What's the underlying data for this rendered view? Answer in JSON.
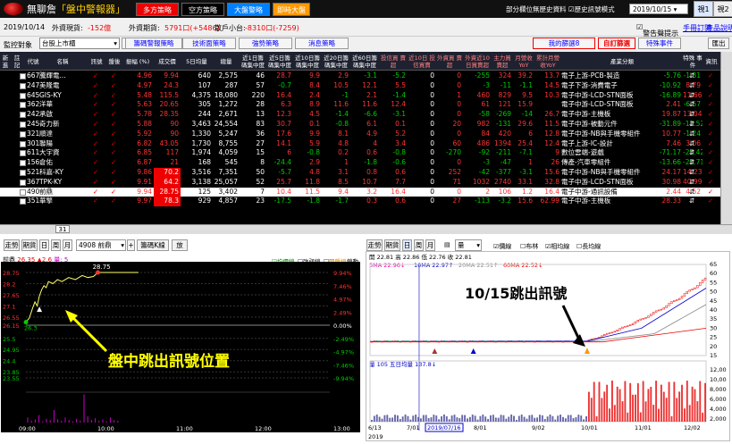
{
  "titlebar": {
    "app_name": "無聊詹",
    "app_subtitle": "「盤中警報器」",
    "buttons": [
      "多方策略",
      "空方策略",
      "大盤警略",
      "即時大盤"
    ],
    "right_links": [
      "部分欄位無歷史資料",
      "歷史訊號模式"
    ],
    "date": "2019/10/15",
    "window_tabs": [
      "視1",
      "視2"
    ]
  },
  "infobar": {
    "date": "2019/10/14",
    "foreign_futures_label": "外資現貨:",
    "foreign_futures_value": "-152億",
    "foreign_spot_label": "外資期貨:",
    "foreign_spot_value": "5791口(+5486)",
    "retail_label": "散戶小台:",
    "retail_value": "-8310口(-7259)",
    "alert_label": "警告聲提示",
    "manual_link": "手冊訂閱",
    "product_link": "產品說明"
  },
  "toolbar": {
    "monitor_label": "監控對象",
    "monitor_value": "台股上市櫃",
    "buttons": [
      "籌碼警報策略",
      "技術面策略",
      "強勢策略",
      "消息策略"
    ],
    "my_strategy": "我的篩選8",
    "custom_strategy": "自訂篩選",
    "special_event": "特殊事件",
    "export": "匯出"
  },
  "table": {
    "headers": [
      "新\n進",
      "註\n記",
      "代號",
      "名稱",
      "訊號",
      "盤後",
      "振幅\n(%)",
      "成交價",
      "5日均量",
      "總量",
      "近1日籌\n碼集中度",
      "近5日籌\n碼集中度",
      "近10日籌\n碼集中度",
      "近20日籌\n碼集中度",
      "近60日籌\n碼集中度",
      "投信買\n賣超",
      "近10日\n投信買賣",
      "外資買\n賣超",
      "外資近10\n日買賣超",
      "主力買\n賣超",
      "月營收\nYoY",
      "累計月營\n收YoY",
      "產業分類",
      "特殊\n事件",
      "資訊"
    ],
    "rows": [
      {
        "code": "6672",
        "name": "騰輝電...",
        "amp": "4.96",
        "chg": "9.94",
        "price": "640",
        "vol5": "2,575",
        "vol": "46",
        "c1": "28.7",
        "c5": "9.9",
        "c10": "2.9",
        "c20": "-3.1",
        "c60": "-5.2",
        "tb": "0",
        "tb10": "0",
        "fb": "-255",
        "fb10": "324",
        "mb": "39.2",
        "yoy": "13.7",
        "cyoy": "-5.76",
        "cyoy2": "-1.31",
        "ind": "電子上游-PCB-製造"
      },
      {
        "code": "2477",
        "name": "美隆電",
        "amp": "4.97",
        "chg": "24.3",
        "price": "107",
        "vol5": "287",
        "vol": "57",
        "c1": "-0.7",
        "c5": "8.4",
        "c10": "10.5",
        "c20": "12.1",
        "c60": "5.5",
        "tb": "0",
        "tb10": "0",
        "fb": "-3",
        "fb10": "-11",
        "mb": "-1.1",
        "yoy": "14.5",
        "cyoy": "-10.92",
        "cyoy2": "8.79",
        "ind": "電子下游-消費電子"
      },
      {
        "code": "6456",
        "name": "GIS-KY",
        "amp": "5.48",
        "chg": "115.5",
        "price": "4,375",
        "vol5": "18,080",
        "vol": "220",
        "c1": "16.4",
        "c5": "2.4",
        "c10": "-1",
        "c20": "2.1",
        "c60": "-1.4",
        "tb": "0",
        "tb10": "1",
        "fb": "460",
        "fb10": "829",
        "mb": "9.5",
        "yoy": "10.3",
        "cyoy": "-16.89",
        "cyoy2": "11.66",
        "ind": "電子中游-LCD-STN面板"
      },
      {
        "code": "3622",
        "name": "洋華",
        "amp": "5.63",
        "chg": "20.65",
        "price": "305",
        "vol5": "1,272",
        "vol": "28",
        "c1": "6.3",
        "c5": "8.9",
        "c10": "11.6",
        "c20": "11.6",
        "c60": "12.4",
        "tb": "0",
        "tb10": "0",
        "fb": "61",
        "fb10": "121",
        "mb": "15.9",
        "yoy": "",
        "cyoy": "2.41",
        "cyoy2": "-6.57",
        "ind": "電子中游-LCD-STN面板"
      },
      {
        "code": "2425",
        "name": "承啟",
        "amp": "5.78",
        "chg": "28.35",
        "price": "244",
        "vol5": "2,671",
        "vol": "13",
        "c1": "12.3",
        "c5": "4.5",
        "c10": "-1.4",
        "c20": "-6.6",
        "c60": "-3.1",
        "tb": "0",
        "tb10": "0",
        "fb": "-58",
        "fb10": "-269",
        "mb": "-14",
        "yoy": "26.7",
        "cyoy": "19.87",
        "cyoy2": "13.04",
        "ind": "電子中游-主機板"
      },
      {
        "code": "2456",
        "name": "奇力新",
        "amp": "5.88",
        "chg": "90",
        "price": "3,463",
        "vol5": "24,554",
        "vol": "83",
        "c1": "30.7",
        "c5": "0.1",
        "c10": "-0.8",
        "c20": "6.1",
        "c60": "0.1",
        "tb": "0",
        "tb10": "20",
        "fb": "982",
        "fb10": "-131",
        "mb": "29.6",
        "yoy": "11.5",
        "cyoy": "-31.89",
        "cyoy2": "-11.52",
        "ind": "電子中游-被動元件"
      },
      {
        "code": "3211",
        "name": "順達",
        "amp": "5.92",
        "chg": "90",
        "price": "1,330",
        "vol5": "5,247",
        "vol": "36",
        "c1": "17.6",
        "c5": "9.9",
        "c10": "8.1",
        "c20": "4.9",
        "c60": "5.2",
        "tb": "0",
        "tb10": "0",
        "fb": "84",
        "fb10": "420",
        "mb": "6",
        "yoy": "12.8",
        "cyoy": "10.77",
        "cyoy2": "-1.24",
        "ind": "電子中游-NB與手機零組件"
      },
      {
        "code": "3014",
        "name": "聯陽",
        "amp": "6.82",
        "chg": "43.05",
        "price": "1,730",
        "vol5": "8,755",
        "vol": "27",
        "c1": "14.1",
        "c5": "5.9",
        "c10": "4.8",
        "c20": "4",
        "c60": "3.4",
        "tb": "0",
        "tb10": "60",
        "fb": "486",
        "fb10": "1394",
        "mb": "25.4",
        "yoy": "12.4",
        "cyoy": "7.46",
        "cyoy2": "3.06",
        "ind": "電子上游-IC-設計"
      },
      {
        "code": "6111",
        "name": "大宇資",
        "amp": "6.85",
        "chg": "117",
        "price": "1,974",
        "vol5": "4,059",
        "vol": "15",
        "c1": "6",
        "c5": "-0.8",
        "c10": "0.2",
        "c20": "0.6",
        "c60": "-0.8",
        "tb": "0",
        "tb10": "-270",
        "fb": "-92",
        "fb10": "-211",
        "mb": "-7.1",
        "yoy": "9",
        "cyoy": "-71.17",
        "cyoy2": "-25.42",
        "ind": "數位雲端-遊戲"
      },
      {
        "code": "1568",
        "name": "倉佑",
        "amp": "6.87",
        "chg": "21",
        "price": "168",
        "vol5": "545",
        "vol": "8",
        "c1": "-24.4",
        "c5": "2.9",
        "c10": "1",
        "c20": "-1.8",
        "c60": "-0.6",
        "tb": "0",
        "tb10": "0",
        "fb": "-3",
        "fb10": "-47",
        "mb": "1",
        "yoy": "26",
        "cyoy": "-13.66",
        "cyoy2": "-25.71",
        "ind": "傳產-汽車零組件"
      },
      {
        "code": "5215",
        "name": "科嘉-KY",
        "amp": "9.86",
        "chg": "70.2",
        "price": "3,516",
        "vol5": "7,351",
        "vol": "50",
        "c1": "-5.7",
        "c5": "4.8",
        "c10": "3.1",
        "c20": "0.8",
        "c60": "0.6",
        "tb": "0",
        "tb10": "252",
        "fb": "-42",
        "fb10": "-377",
        "mb": "-3.1",
        "yoy": "15.6",
        "cyoy": "24.17",
        "cyoy2": "14.23",
        "ind": "電子中游-NB與手機零組件"
      },
      {
        "code": "3673",
        "name": "TPK-KY",
        "amp": "9.91",
        "chg": "64.2",
        "price": "3,138",
        "vol5": "25,057",
        "vol": "52",
        "c1": "25.7",
        "c5": "11.8",
        "c10": "8.5",
        "c20": "10.7",
        "c60": "7.7",
        "tb": "0",
        "tb10": "71",
        "fb": "1032",
        "fb10": "2740",
        "mb": "33.1",
        "yoy": "32.8",
        "cyoy": "30.98",
        "cyoy2": "40.99",
        "ind": "電子中游-LCD-STN面板"
      },
      {
        "code": "4908",
        "name": "前鼎",
        "amp": "9.94",
        "chg": "28.75",
        "price": "125",
        "vol5": "3,402",
        "vol": "7",
        "c1": "10.4",
        "c5": "11.5",
        "c10": "9.4",
        "c20": "3.2",
        "c60": "16.4",
        "tb": "0",
        "tb10": "0",
        "fb": "2",
        "fb10": "106",
        "mb": "1.2",
        "yoy": "16.4",
        "cyoy": "2.44",
        "cyoy2": "4.52",
        "ind": "電子中游-通訊設備"
      },
      {
        "code": "3515",
        "name": "華擎",
        "amp": "9.97",
        "chg": "78.3",
        "price": "929",
        "vol5": "4,857",
        "vol": "23",
        "c1": "-17.5",
        "c5": "-1.8",
        "c10": "-1.7",
        "c20": "0.3",
        "c60": "0.6",
        "tb": "0",
        "tb10": "27",
        "fb": "-113",
        "fb10": "-3.2",
        "mb": "15.6",
        "yoy": "62.99",
        "cyoy": "28.33",
        "cyoy2": "",
        "ind": "電子中游-主機板"
      }
    ],
    "page": "31"
  },
  "left_panel": {
    "tabs": [
      "走勢",
      "期貨",
      "日",
      "周",
      "月"
    ],
    "stock_select": "4908 前鼎",
    "reset_label": "籌碼K線",
    "zoom_label": "放",
    "legend": [
      "均價線",
      "強弱線",
      "開盤線"
    ],
    "lock_label": "鎖動",
    "stock_header": "前鼎",
    "price_now": "26.35",
    "chg_now": "▲2.6",
    "vol_now": "量: 5",
    "y_prices": [
      "28.75",
      "28.2",
      "27.65",
      "27.1",
      "26.55",
      "26.15",
      "25.5",
      "24.95",
      "24.4",
      "23.85",
      "23.55"
    ],
    "y_pcts": [
      "9.94%",
      "7.46%",
      "4.97%",
      "2.49%",
      "0.00%",
      "-2.49%",
      "-4.97%",
      "-7.46%",
      "-9.94%"
    ],
    "x_labels": [
      "09:00",
      "10:00",
      "11:00",
      "12:00",
      "13:00"
    ],
    "open_price_label": "26.3",
    "high_label": "28.75",
    "annotation": "盤中跳出訊號位置"
  },
  "right_panel": {
    "tabs": [
      "走勢",
      "期貨",
      "日",
      "周",
      "月"
    ],
    "select_label": "量",
    "toggles": [
      "價線",
      "布林",
      "相均線",
      "長均線"
    ],
    "ohlc": "開 22.81 高 22.86 低 22.76 收 22.81",
    "ma_legend": [
      "5MA 22.96↓",
      "10MA 22.97↑",
      "20MA 22.51↑",
      "60MA 22.52↓"
    ],
    "y_labels": [
      "65",
      "60",
      "55",
      "50",
      "45",
      "40",
      "35",
      "30",
      "25",
      "20",
      "15"
    ],
    "vol_legend": "量 105 五日均量 137.8↓",
    "vol_y_labels": [
      "12,00",
      "10,00",
      "8,000",
      "6,000",
      "4,000",
      "2,000"
    ],
    "x_labels": [
      "6/13",
      "7/01",
      "2019/07/16",
      "8/01",
      "9/02",
      "10/01",
      "11/01",
      "12/02"
    ],
    "year_label": "2019",
    "annotation": "10/15跳出訊號"
  },
  "colors": {
    "up": "#e00000",
    "down": "#00a000",
    "accent": "#ffcc00"
  }
}
